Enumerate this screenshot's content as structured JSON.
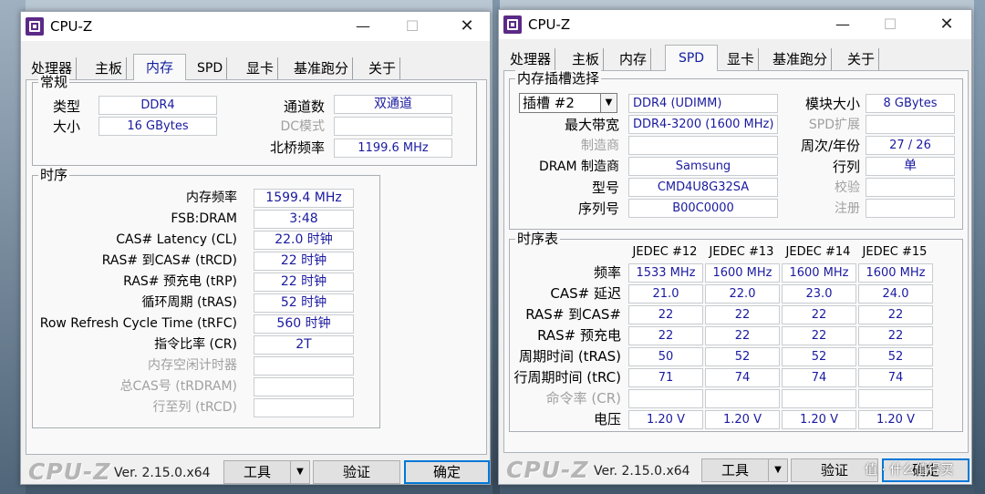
{
  "app_title": "CPU-Z",
  "window_controls": {
    "minimize": "—",
    "maximize": "☐",
    "close": "✕"
  },
  "tabs": [
    "处理器",
    "主板",
    "内存",
    "SPD",
    "显卡",
    "基准跑分",
    "关于"
  ],
  "left": {
    "active_tab": "内存",
    "general": {
      "title": "常规",
      "type_label": "类型",
      "type_value": "DDR4",
      "size_label": "大小",
      "size_value": "16 GBytes",
      "channels_label": "通道数",
      "channels_value": "双通道",
      "dc_mode_label": "DC模式",
      "dc_mode_value": "",
      "nb_freq_label": "北桥频率",
      "nb_freq_value": "1199.6 MHz"
    },
    "timings": {
      "title": "时序",
      "rows": [
        {
          "label": "内存频率",
          "value": "1599.4 MHz",
          "disabled": false
        },
        {
          "label": "FSB:DRAM",
          "value": "3:48",
          "disabled": false
        },
        {
          "label": "CAS# Latency (CL)",
          "value": "22.0 时钟",
          "disabled": false
        },
        {
          "label": "RAS# 到CAS# (tRCD)",
          "value": "22 时钟",
          "disabled": false
        },
        {
          "label": "RAS# 预充电 (tRP)",
          "value": "22 时钟",
          "disabled": false
        },
        {
          "label": "循环周期 (tRAS)",
          "value": "52 时钟",
          "disabled": false
        },
        {
          "label": "Row Refresh Cycle Time (tRFC)",
          "value": "560 时钟",
          "disabled": false
        },
        {
          "label": "指令比率 (CR)",
          "value": "2T",
          "disabled": false
        },
        {
          "label": "内存空闲计时器",
          "value": "",
          "disabled": true
        },
        {
          "label": "总CAS号 (tRDRAM)",
          "value": "",
          "disabled": true
        },
        {
          "label": "行至列 (tRCD)",
          "value": "",
          "disabled": true
        }
      ]
    }
  },
  "right": {
    "active_tab": "SPD",
    "slot_group": {
      "title": "内存插槽选择",
      "slot_value": "插槽 #2",
      "module_type": "DDR4 (UDIMM)",
      "module_size_label": "模块大小",
      "module_size_value": "8 GBytes",
      "max_bw_label": "最大带宽",
      "max_bw_value": "DDR4-3200 (1600 MHz)",
      "spd_ext_label": "SPD扩展",
      "spd_ext_value": "",
      "manufacturer_label": "制造商",
      "manufacturer_value": "",
      "week_year_label": "周次/年份",
      "week_year_value": "27 / 26",
      "dram_mfr_label": "DRAM 制造商",
      "dram_mfr_value": "Samsung",
      "ranks_label": "行列",
      "ranks_value": "单",
      "part_label": "型号",
      "part_value": "CMD4U8G32SA",
      "checksum_label": "校验",
      "checksum_value": "",
      "serial_label": "序列号",
      "serial_value": "B00C0000",
      "registered_label": "注册",
      "registered_value": ""
    },
    "timing_table": {
      "title": "时序表",
      "columns": [
        "JEDEC #12",
        "JEDEC #13",
        "JEDEC #14",
        "JEDEC #15"
      ],
      "rows": [
        {
          "label": "频率",
          "values": [
            "1533 MHz",
            "1600 MHz",
            "1600 MHz",
            "1600 MHz"
          ],
          "disabled": false
        },
        {
          "label": "CAS# 延迟",
          "values": [
            "21.0",
            "22.0",
            "23.0",
            "24.0"
          ],
          "disabled": false
        },
        {
          "label": "RAS# 到CAS#",
          "values": [
            "22",
            "22",
            "22",
            "22"
          ],
          "disabled": false
        },
        {
          "label": "RAS# 预充电",
          "values": [
            "22",
            "22",
            "22",
            "22"
          ],
          "disabled": false
        },
        {
          "label": "周期时间 (tRAS)",
          "values": [
            "50",
            "52",
            "52",
            "52"
          ],
          "disabled": false
        },
        {
          "label": "行周期时间 (tRC)",
          "values": [
            "71",
            "74",
            "74",
            "74"
          ],
          "disabled": false
        },
        {
          "label": "命令率 (CR)",
          "values": [
            "",
            "",
            "",
            ""
          ],
          "disabled": true
        },
        {
          "label": "电压",
          "values": [
            "1.20 V",
            "1.20 V",
            "1.20 V",
            "1.20 V"
          ],
          "disabled": false
        }
      ]
    }
  },
  "bottom": {
    "brand": "CPU-Z",
    "version": "Ver. 2.15.0.x64",
    "tools_label": "工具",
    "validate_label": "验证",
    "ok_label": "确定"
  },
  "watermark": "值 · 什么值得买"
}
